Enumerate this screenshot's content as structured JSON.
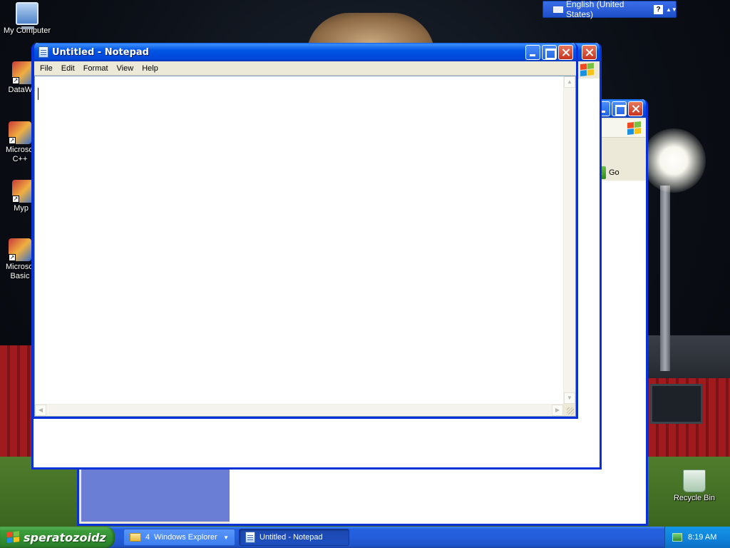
{
  "desktop": {
    "icons": [
      {
        "label": "My Computer"
      },
      {
        "label": "DataWar"
      },
      {
        "label": "Microsoft C++"
      },
      {
        "label": "Myp"
      },
      {
        "label": "Microsoft Basic"
      },
      {
        "label": "Recycle Bin"
      }
    ]
  },
  "langbar": {
    "language": "English (United States)",
    "help_glyph": "?",
    "options_glyph": "▲▼"
  },
  "notepad": {
    "title": "Untitled - Notepad",
    "menu": [
      "File",
      "Edit",
      "Format",
      "View",
      "Help"
    ],
    "content": ""
  },
  "explorer": {
    "go_label": "Go"
  },
  "taskbar": {
    "start_label": "speratozoidz",
    "groups": [
      {
        "count": "4",
        "label": "Windows Explorer"
      },
      {
        "count": "",
        "label": "Untitled - Notepad"
      }
    ],
    "clock": "8:19 AM"
  },
  "colors": {
    "title_blue": "#0055e5",
    "taskbar_blue": "#245edb",
    "start_green": "#3c9c3b",
    "tray_blue": "#0f80d8"
  }
}
